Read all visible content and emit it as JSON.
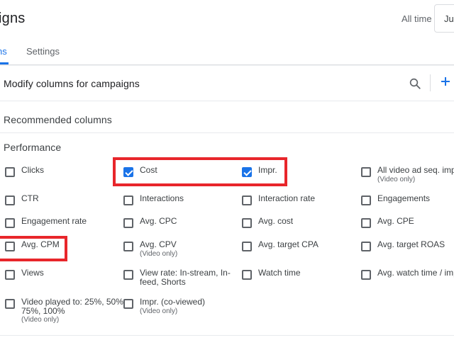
{
  "header": {
    "title": "igns",
    "date_range_label": "All time",
    "date_button": "Jul",
    "tabs": [
      {
        "label": "ns",
        "active": true
      },
      {
        "label": "Settings",
        "active": false
      }
    ]
  },
  "panel": {
    "title": "Modify columns for campaigns",
    "recommended_heading": "Recommended columns",
    "performance_heading": "Performance",
    "options": [
      {
        "label": "Clicks",
        "checked": false
      },
      {
        "label": "Cost",
        "checked": true
      },
      {
        "label": "Impr.",
        "checked": true
      },
      {
        "label": "All video ad seq. impr",
        "sub": "(Video only)",
        "checked": false
      },
      {
        "label": "CTR",
        "checked": false
      },
      {
        "label": "Interactions",
        "checked": false
      },
      {
        "label": "Interaction rate",
        "checked": false
      },
      {
        "label": "Engagements",
        "checked": false
      },
      {
        "label": "Engagement rate",
        "checked": false
      },
      {
        "label": "Avg. CPC",
        "checked": false
      },
      {
        "label": "Avg. cost",
        "checked": false
      },
      {
        "label": "Avg. CPE",
        "checked": false
      },
      {
        "label": "Avg. CPM",
        "checked": false
      },
      {
        "label": "Avg. CPV",
        "sub": "(Video only)",
        "checked": false
      },
      {
        "label": "Avg. target CPA",
        "checked": false
      },
      {
        "label": "Avg. target ROAS",
        "checked": false
      },
      {
        "label": "Views",
        "checked": false
      },
      {
        "label": "View rate: In-stream, In-",
        "label2": "feed, Shorts",
        "checked": false
      },
      {
        "label": "Watch time",
        "checked": false
      },
      {
        "label": "Avg. watch time / impr",
        "checked": false
      },
      {
        "label": "Video played to: 25%, 50%,",
        "label2": "75%, 100%",
        "sub": "(Video only)",
        "checked": false
      },
      {
        "label": "Impr. (co-viewed)",
        "sub": "(Video only)",
        "checked": false
      }
    ]
  },
  "colors": {
    "accent": "#1a73e8",
    "highlight": "#e8262b"
  }
}
